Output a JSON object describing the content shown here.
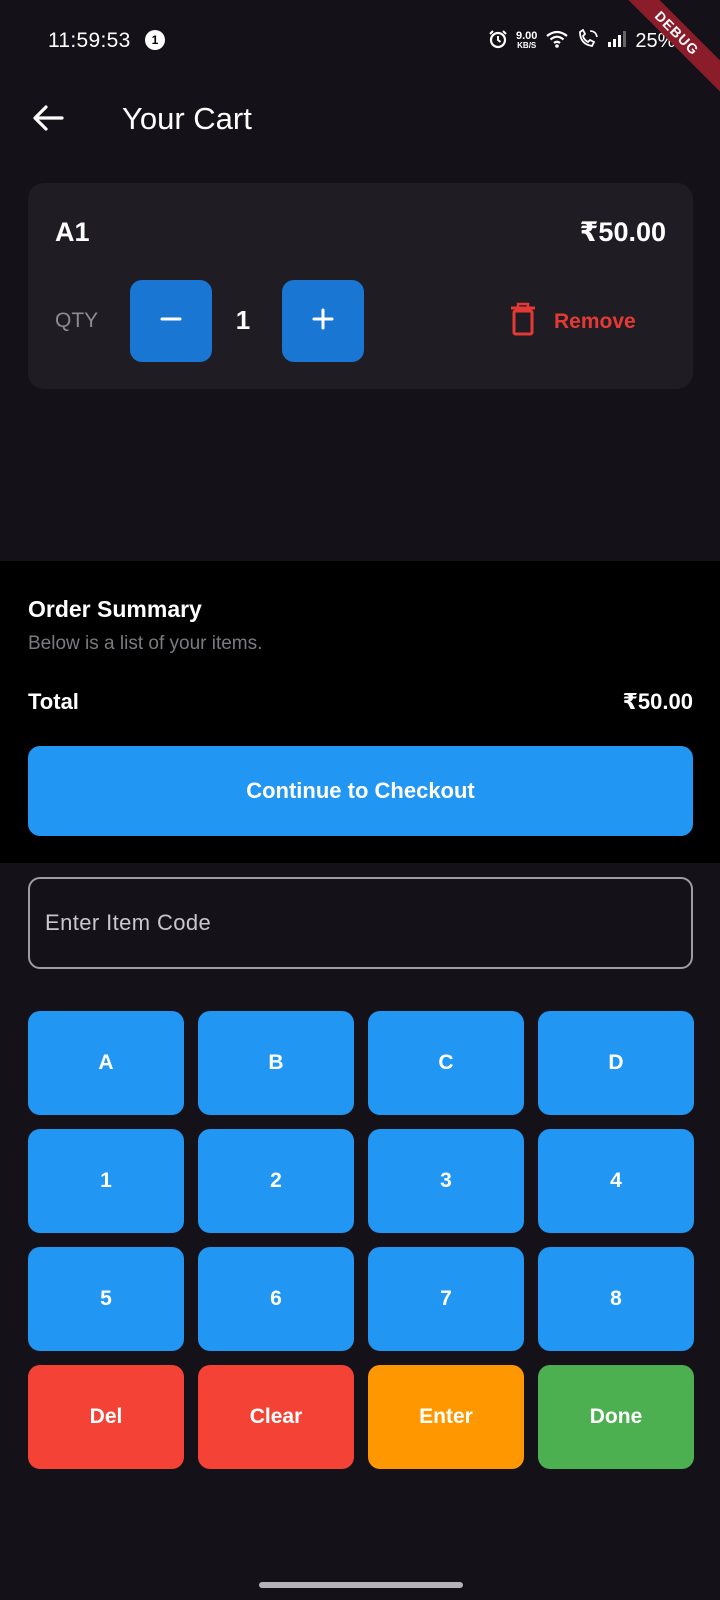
{
  "status_bar": {
    "time": "11:59:53",
    "notification_count": "1",
    "net_speed_value": "9.00",
    "net_speed_unit": "KB/S",
    "battery": "25%"
  },
  "debug_banner": "DEBUG",
  "app_bar": {
    "title": "Your Cart",
    "back_icon": "arrow-left-icon"
  },
  "cart": {
    "items": [
      {
        "name": "A1",
        "price": "₹50.00",
        "qty_label": "QTY",
        "qty": "1",
        "remove_label": "Remove"
      }
    ]
  },
  "summary": {
    "title": "Order Summary",
    "subtitle": "Below is a list of your items.",
    "total_label": "Total",
    "total_value": "₹50.00",
    "checkout_label": "Continue to Checkout"
  },
  "item_code_input": {
    "placeholder": "Enter Item Code",
    "value": ""
  },
  "keypad": {
    "keys": [
      "A",
      "B",
      "C",
      "D",
      "1",
      "2",
      "3",
      "4",
      "5",
      "6",
      "7",
      "8",
      "Del",
      "Clear",
      "Enter",
      "Done"
    ]
  },
  "colors": {
    "background": "#141218",
    "card": "#1f1d23",
    "summary_background": "#000000",
    "primary": "#2196f3",
    "qty_button": "#1976d2",
    "danger": "#f44336",
    "remove": "#e53935",
    "warning": "#ff9800",
    "success": "#4caf50"
  }
}
